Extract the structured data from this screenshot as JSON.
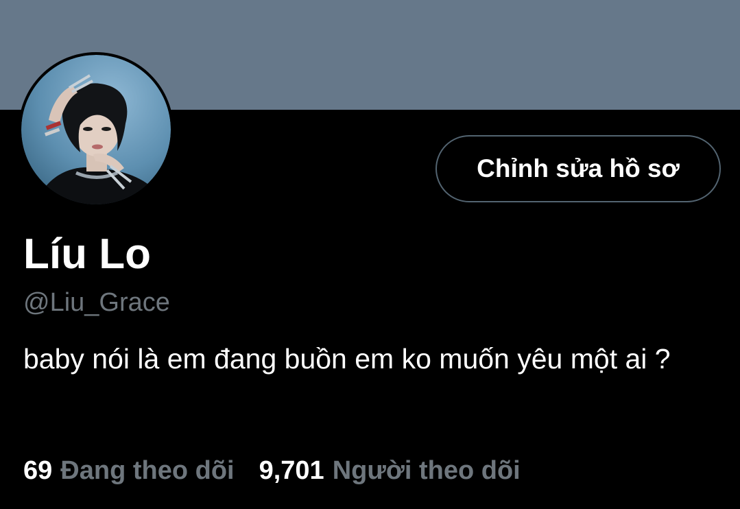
{
  "profile": {
    "banner_color": "#66788a",
    "avatar_icon": "profile-photo",
    "edit_button_label": "Chỉnh sửa hồ sơ",
    "display_name": "Líu Lo",
    "handle": "@Liu_Grace",
    "bio": "baby nói là em đang buồn em ko muốn yêu một ai ?",
    "following_count": "69",
    "following_label": "Đang theo dõi",
    "followers_count": "9,701",
    "followers_label": "Người theo dõi"
  },
  "colors": {
    "background": "#000000",
    "text_primary": "#ffffff",
    "text_secondary": "#6e767d",
    "button_border": "#536471"
  }
}
